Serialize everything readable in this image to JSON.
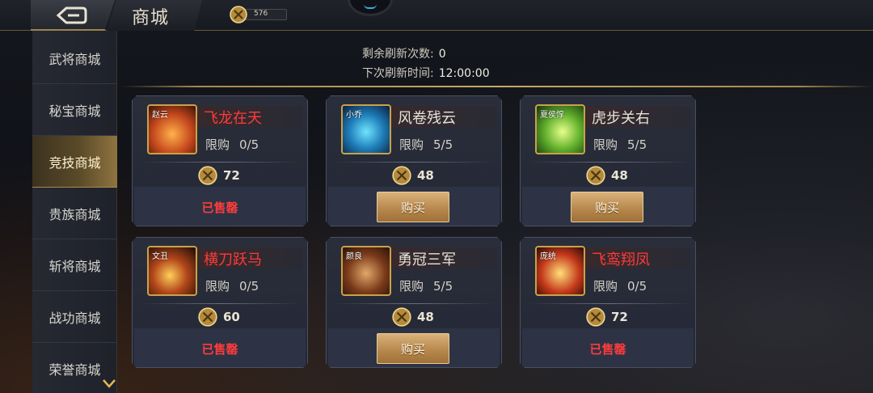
{
  "header": {
    "title": "商城",
    "currency_value": "576",
    "back_icon": "back-arrow-icon"
  },
  "sidebar": {
    "items": [
      {
        "label": "武将商城",
        "active": false
      },
      {
        "label": "秘宝商城",
        "active": false
      },
      {
        "label": "竞技商城",
        "active": true
      },
      {
        "label": "贵族商城",
        "active": false
      },
      {
        "label": "斩将商城",
        "active": false
      },
      {
        "label": "战功商城",
        "active": false
      },
      {
        "label": "荣誉商城",
        "active": false
      }
    ]
  },
  "refresh": {
    "remaining_label": "剩余刷新次数:",
    "remaining_value": "0",
    "next_label": "下次刷新时间:",
    "next_value": "12:00:00"
  },
  "cards": [
    {
      "tag": "赵云",
      "name": "飞龙在天",
      "name_red": true,
      "limit_label": "限购",
      "limit": "0/5",
      "price": "72",
      "status": "已售罄",
      "sold_out": true
    },
    {
      "tag": "小乔",
      "name": "风卷残云",
      "name_red": false,
      "limit_label": "限购",
      "limit": "5/5",
      "price": "48",
      "status": "购买",
      "sold_out": false
    },
    {
      "tag": "夏侯惇",
      "name": "虎步关右",
      "name_red": false,
      "limit_label": "限购",
      "limit": "5/5",
      "price": "48",
      "status": "购买",
      "sold_out": false
    },
    {
      "tag": "文丑",
      "name": "横刀跃马",
      "name_red": true,
      "limit_label": "限购",
      "limit": "0/5",
      "price": "60",
      "status": "已售罄",
      "sold_out": true
    },
    {
      "tag": "颜良",
      "name": "勇冠三军",
      "name_red": false,
      "limit_label": "限购",
      "limit": "5/5",
      "price": "48",
      "status": "购买",
      "sold_out": false
    },
    {
      "tag": "庞统",
      "name": "飞鸾翔凤",
      "name_red": true,
      "limit_label": "限购",
      "limit": "0/5",
      "price": "72",
      "status": "已售罄",
      "sold_out": true
    }
  ],
  "colors": {
    "accent_gold": "#c9a24a",
    "sold_out_red": "#ff3c3c",
    "panel": "#2a2e3a"
  }
}
